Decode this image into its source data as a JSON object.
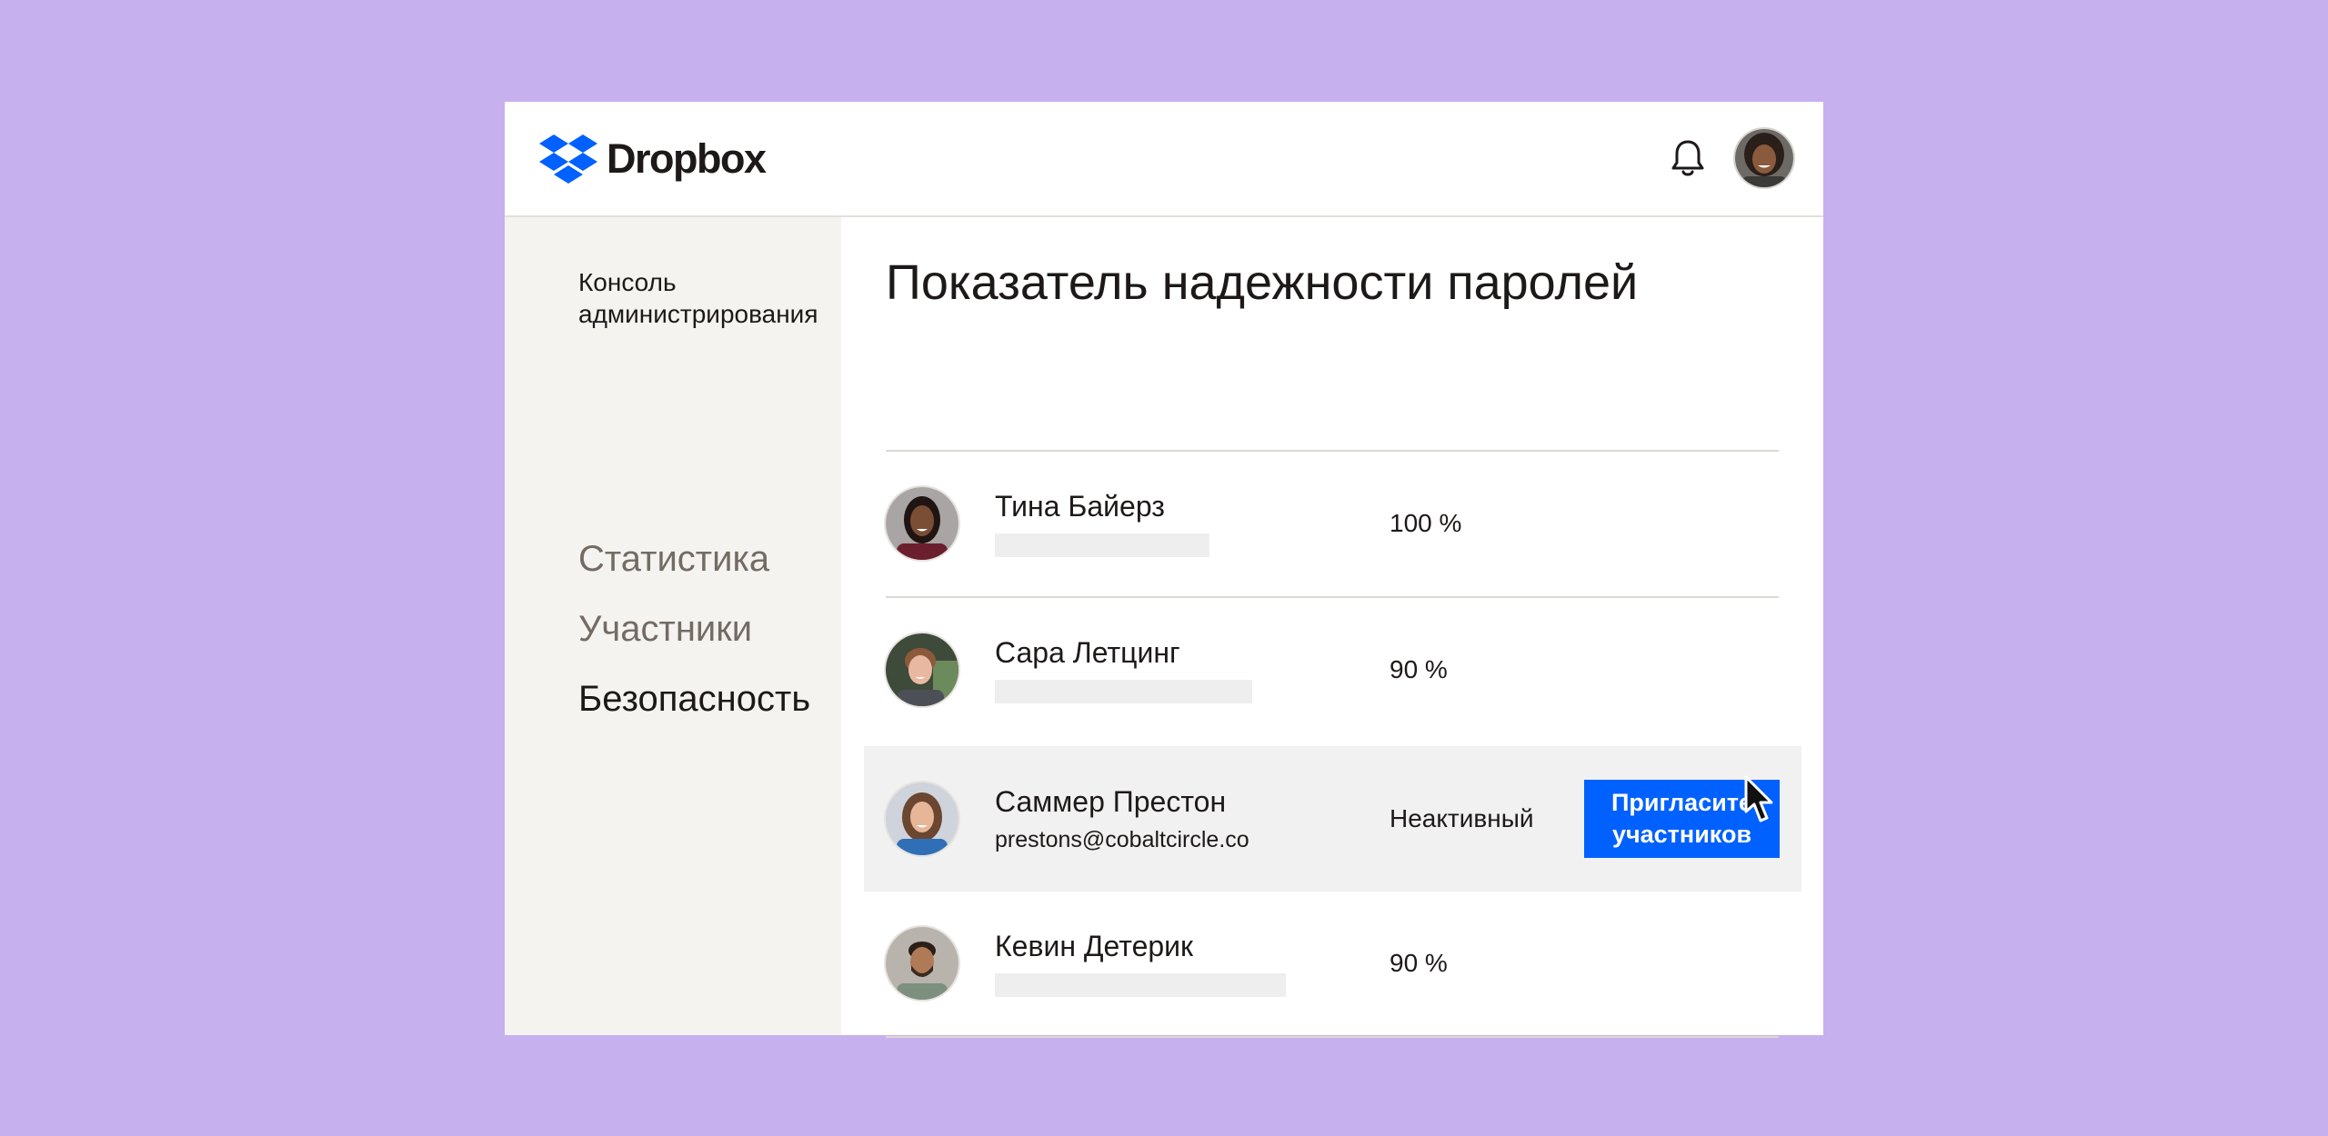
{
  "colors": {
    "background": "#c7b0ee",
    "brand_blue": "#0061fe",
    "sidebar_bg": "#f5f3f0",
    "highlight_row": "#f1f1f1",
    "text": "#1e1919",
    "muted_text": "#736c64"
  },
  "header": {
    "logo_text": "Dropbox",
    "logo_icon": "dropbox-logo-icon",
    "notifications_icon": "bell-icon",
    "user_avatar": "user-avatar"
  },
  "sidebar": {
    "console_label": "Консоль администрирования",
    "items": [
      {
        "label": "Статистика",
        "active": false
      },
      {
        "label": "Участники",
        "active": false
      },
      {
        "label": "Безопасность",
        "active": true
      }
    ]
  },
  "main": {
    "title": "Показатель надежности паролей",
    "rows": [
      {
        "name": "Тина Байерз",
        "score": "100 %",
        "email": "",
        "bar_fraction": 0.29
      },
      {
        "name": "Сара Летцинг",
        "score": "90 %",
        "email": "",
        "bar_fraction": 0.35
      },
      {
        "name": "Саммер Престон",
        "score": "Неактивный",
        "email": "prestons@cobaltcircle.co",
        "highlighted": true,
        "action_label": "Пригласите участников"
      },
      {
        "name": "Кевин Детерик",
        "score": "90 %",
        "email": "",
        "bar_fraction": 0.39
      }
    ]
  },
  "pointer_icon": "mouse-pointer-icon"
}
